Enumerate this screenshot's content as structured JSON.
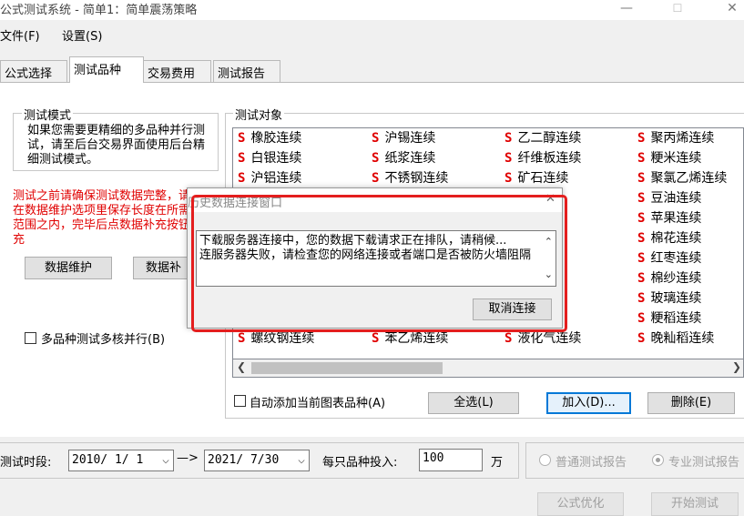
{
  "window": {
    "title": "公式测试系统 - 简单1：简单震荡策略",
    "minimize_glyph": "—",
    "maximize_glyph": "☐",
    "close_glyph": "✕"
  },
  "menu": [
    "文件(F)",
    "设置(S)"
  ],
  "tabs": [
    {
      "label": "公式选择",
      "active": false
    },
    {
      "label": "测试品种",
      "active": true
    },
    {
      "label": "交易费用",
      "active": false
    },
    {
      "label": "测试报告",
      "active": false
    }
  ],
  "test_mode": {
    "label": "测试模式",
    "description": "如果您需要更精细的多品种并行测试，请至后台交易界面使用后台精细测试模式。"
  },
  "warning_text": "测试之前请确保测试数据完整，请先在数据维护选项里保存长度在所需要范围之内，完毕后点数据补充按钮补充",
  "buttons": {
    "data_maintain": "数据维护",
    "data_supplement": "数据补",
    "select_all": "全选(L)",
    "add": "加入(D)...",
    "delete": "删除(E)",
    "optimize": "公式优化",
    "start_test": "开始测试"
  },
  "multi_core": {
    "label": "多品种测试多核并行(B)",
    "checked": false
  },
  "test_objects": {
    "label": "测试对象",
    "marker": "S",
    "columns": [
      [
        "橡胶连续",
        "白银连续",
        "沪铝连续",
        "",
        "",
        "",
        "",
        "",
        "",
        "",
        "螺纹钢连续"
      ],
      [
        "沪锡连续",
        "纸浆连续",
        "不锈钢连续",
        "",
        "",
        "",
        "",
        "",
        "",
        "",
        "苯乙烯连续"
      ],
      [
        "乙二醇连续",
        "纤维板连续",
        "矿石连续",
        "",
        "",
        "",
        "",
        "",
        "",
        "",
        "液化气连续"
      ],
      [
        "聚丙烯连续",
        "粳米连续",
        "聚氯乙烯连续",
        "豆油连续",
        "苹果连续",
        "棉花连续",
        "红枣连续",
        "棉纱连续",
        "玻璃连续",
        "粳稻连续",
        "晚籼稻连续"
      ]
    ]
  },
  "auto_add": {
    "label": "自动添加当前图表品种(A)",
    "checked": false
  },
  "bottom": {
    "period_label": "测试时段:",
    "start_date": "2010/ 1/ 1",
    "arrow": "—>",
    "end_date": "2021/ 7/30",
    "invest_label": "每只品种投入:",
    "invest_value": "100",
    "unit": "万",
    "report_normal": "普通测试报告",
    "report_pro": "专业测试报告",
    "selected_report": "专业测试报告"
  },
  "dialog": {
    "title": "历史数据连接窗口",
    "message": "下载服务器连接中，您的数据下载请求正在排队，请稍候...\n连服务器失败，请检查您的网络连接或者端口是否被防火墙阻隔",
    "cancel_button": "取消连接",
    "close_glyph": "✕"
  },
  "colors": {
    "accent_red": "#e00000",
    "highlight_border": "#e41e1e"
  }
}
